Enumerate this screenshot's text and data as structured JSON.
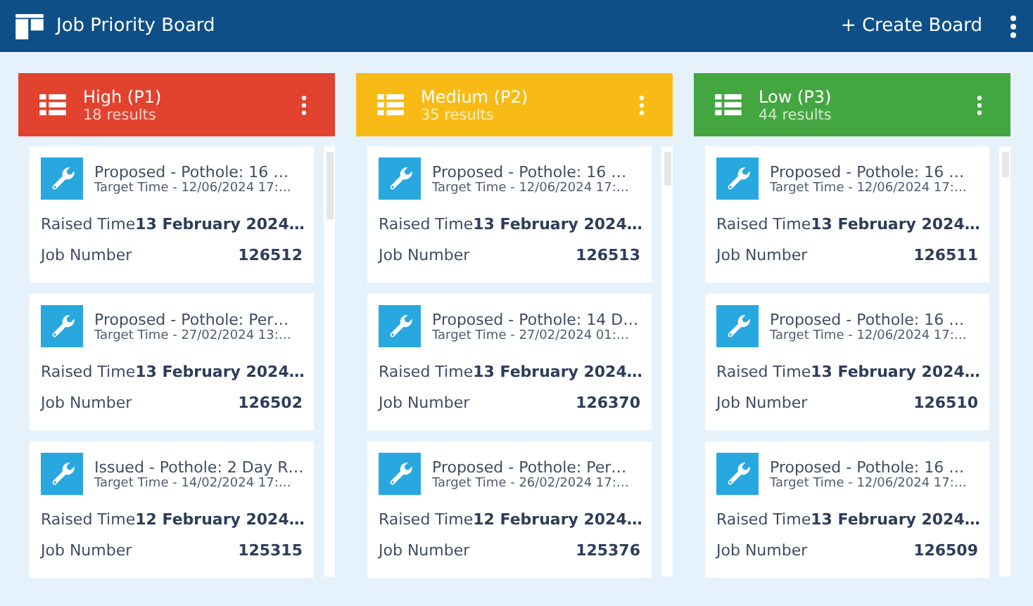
{
  "header": {
    "title": "Job Priority Board",
    "create_button": "+ Create Board"
  },
  "columns": [
    {
      "title": "High (P1)",
      "count": "18 results",
      "color": "#e2432f",
      "cards": [
        {
          "title": "Proposed - Pothole: 16 …",
          "target": "Target Time - 12/06/2024 17:…",
          "raised_label": "Raised Time",
          "raised": "13 February 2024…",
          "job_label": "Job Number",
          "job": "126512"
        },
        {
          "title": "Proposed - Pothole: Per…",
          "target": "Target Time - 27/02/2024 13:…",
          "raised_label": "Raised Time",
          "raised": "13 February 2024…",
          "job_label": "Job Number",
          "job": "126502"
        },
        {
          "title": "Issued - Pothole: 2 Day R…",
          "target": "Target Time - 14/02/2024 17:…",
          "raised_label": "Raised Time",
          "raised": "12 February 2024…",
          "job_label": "Job Number",
          "job": "125315"
        }
      ]
    },
    {
      "title": "Medium (P2)",
      "count": "35 results",
      "color": "#f8bb16",
      "cards": [
        {
          "title": "Proposed - Pothole: 16 …",
          "target": "Target Time - 12/06/2024 17:…",
          "raised_label": "Raised Time",
          "raised": "13 February 2024…",
          "job_label": "Job Number",
          "job": "126513"
        },
        {
          "title": "Proposed - Pothole: 14 D…",
          "target": "Target Time - 27/02/2024 01:…",
          "raised_label": "Raised Time",
          "raised": "13 February 2024…",
          "job_label": "Job Number",
          "job": "126370"
        },
        {
          "title": "Proposed - Pothole: Per…",
          "target": "Target Time - 26/02/2024 17:…",
          "raised_label": "Raised Time",
          "raised": "12 February 2024…",
          "job_label": "Job Number",
          "job": "125376"
        }
      ]
    },
    {
      "title": "Low (P3)",
      "count": "44 results",
      "color": "#44a640",
      "cards": [
        {
          "title": "Proposed - Pothole: 16 …",
          "target": "Target Time - 12/06/2024 17:…",
          "raised_label": "Raised Time",
          "raised": "13 February 2024…",
          "job_label": "Job Number",
          "job": "126511"
        },
        {
          "title": "Proposed - Pothole: 16 …",
          "target": "Target Time - 12/06/2024 17:…",
          "raised_label": "Raised Time",
          "raised": "13 February 2024…",
          "job_label": "Job Number",
          "job": "126510"
        },
        {
          "title": "Proposed - Pothole: 16 …",
          "target": "Target Time - 12/06/2024 17:…",
          "raised_label": "Raised Time",
          "raised": "13 February 2024…",
          "job_label": "Job Number",
          "job": "126509"
        }
      ]
    }
  ]
}
